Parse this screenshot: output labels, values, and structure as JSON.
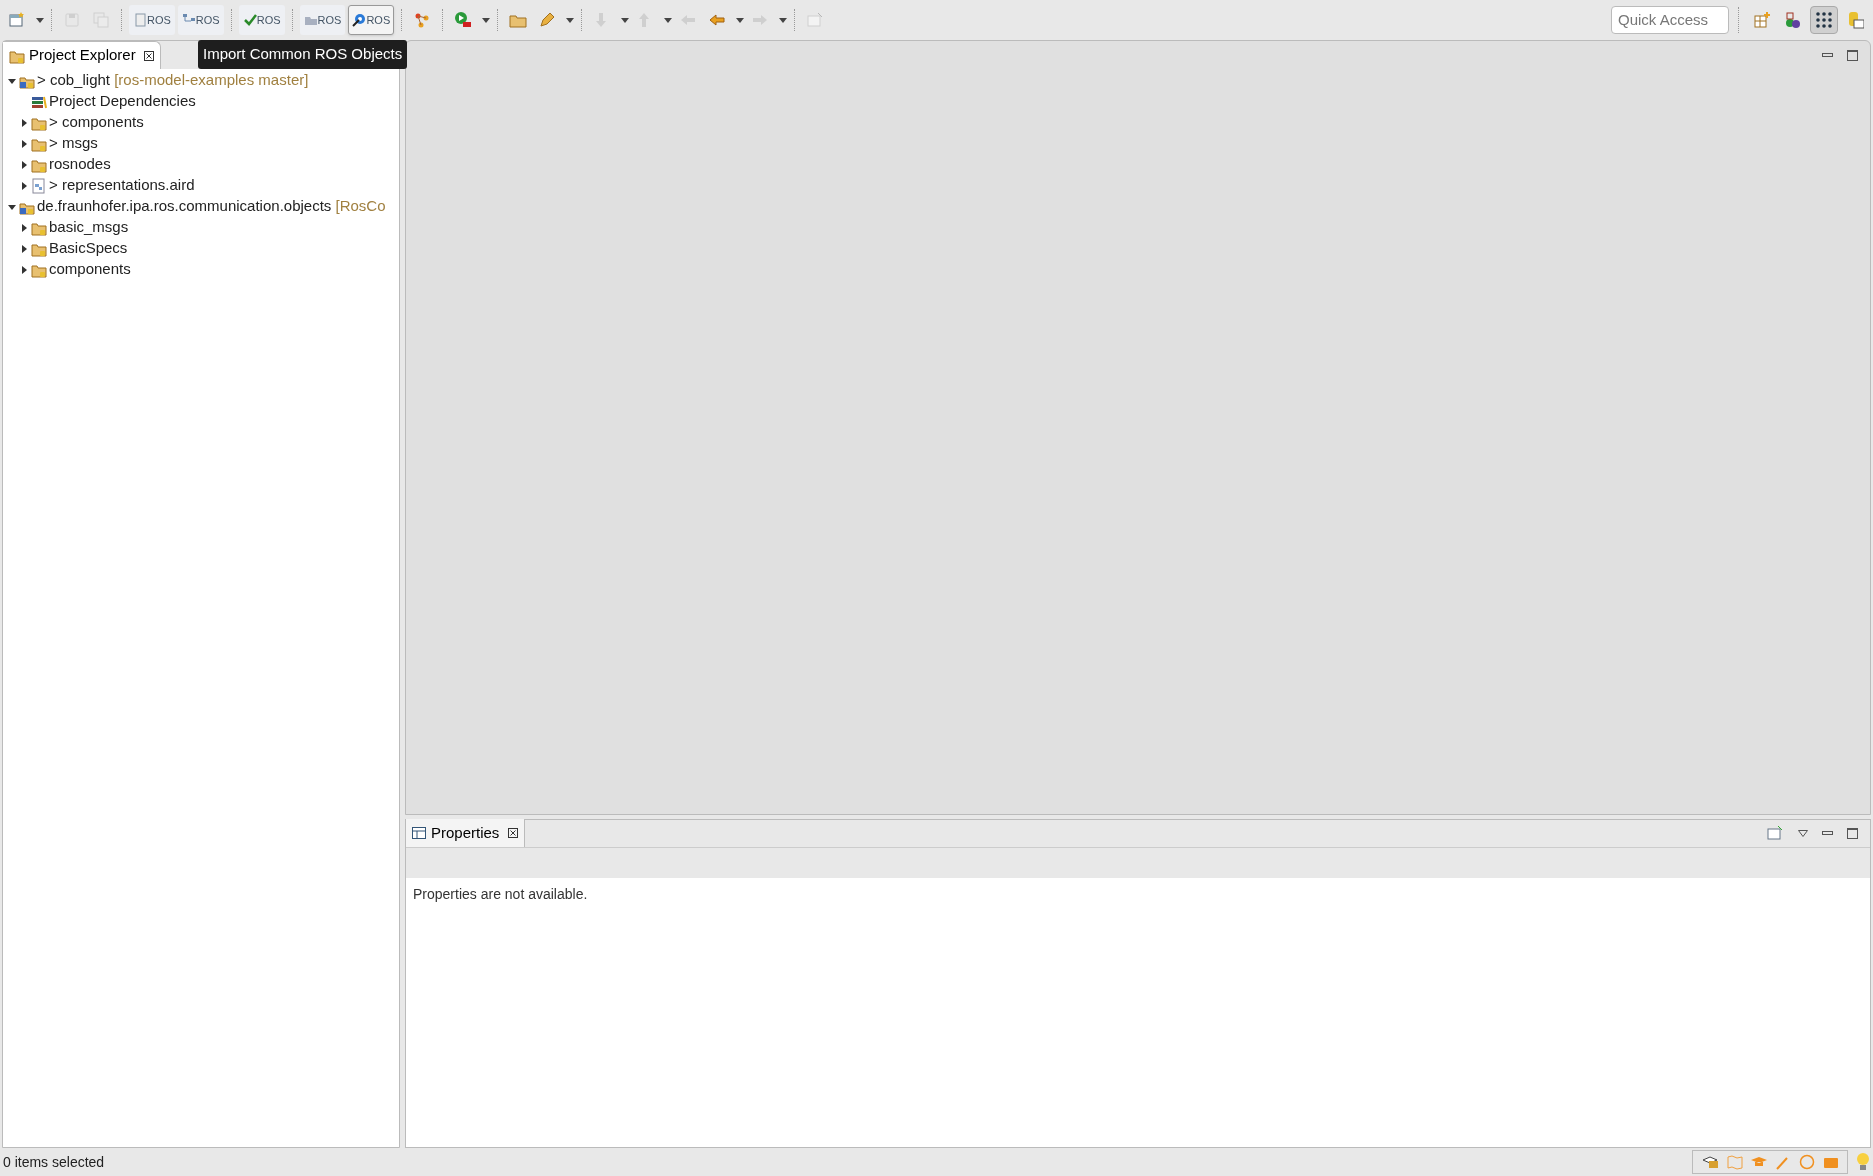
{
  "toolbar": [
    {
      "kind": "new-wizard",
      "dropdown": true,
      "disabled": false
    },
    {
      "kind": "separator"
    },
    {
      "kind": "save",
      "disabled": true
    },
    {
      "kind": "save-all",
      "disabled": true
    },
    {
      "kind": "separator"
    },
    {
      "kind": "ros-file",
      "label": "ROS",
      "selected": false
    },
    {
      "kind": "ros-graph",
      "label": "ROS",
      "selected": false
    },
    {
      "kind": "separator"
    },
    {
      "kind": "ros-check",
      "label": "ROS",
      "selected": false
    },
    {
      "kind": "separator"
    },
    {
      "kind": "ros-folder",
      "label": "ROS",
      "selected": false
    },
    {
      "kind": "ros-gear",
      "label": "ROS",
      "selected": true
    },
    {
      "kind": "separator"
    },
    {
      "kind": "nodes",
      "disabled": false
    },
    {
      "kind": "separator"
    },
    {
      "kind": "run",
      "dropdown": true,
      "disabled": false
    },
    {
      "kind": "separator"
    },
    {
      "kind": "open-folder",
      "disabled": false
    },
    {
      "kind": "pen",
      "dropdown": true,
      "disabled": false
    },
    {
      "kind": "separator"
    },
    {
      "kind": "down",
      "dropdown": true,
      "disabled": true
    },
    {
      "kind": "up",
      "dropdown": true,
      "disabled": true
    },
    {
      "kind": "back-edit",
      "disabled": true
    },
    {
      "kind": "back",
      "dropdown": true,
      "disabled": false
    },
    {
      "kind": "forward",
      "dropdown": true,
      "disabled": true
    },
    {
      "kind": "separator"
    },
    {
      "kind": "pin",
      "disabled": true
    }
  ],
  "tooltip": "Import Common ROS Objects",
  "quick_access": {
    "placeholder": "Quick Access"
  },
  "perspectives": [
    {
      "kind": "open-perspective",
      "selected": false
    },
    {
      "kind": "ros",
      "selected": false
    },
    {
      "kind": "grid",
      "selected": true
    },
    {
      "kind": "git",
      "selected": false
    }
  ],
  "project_explorer": {
    "title": "Project Explorer",
    "tree": [
      {
        "kind": "project",
        "prefix": ">",
        "name": "cob_light",
        "decoration": "[ros-model-examples master]",
        "expanded": true,
        "children": [
          {
            "kind": "dependencies",
            "name": "Project Dependencies"
          },
          {
            "kind": "folder",
            "prefix": ">",
            "name": "components",
            "expanded": false
          },
          {
            "kind": "folder",
            "prefix": ">",
            "name": "msgs",
            "expanded": false
          },
          {
            "kind": "folder",
            "name": "rosnodes",
            "expanded": false
          },
          {
            "kind": "file",
            "prefix": ">",
            "name": "representations.aird",
            "expanded": false
          }
        ]
      },
      {
        "kind": "project",
        "name": "de.fraunhofer.ipa.ros.communication.objects",
        "decoration": "[RosCo",
        "expanded": true,
        "children": [
          {
            "kind": "folder",
            "name": "basic_msgs",
            "expanded": false
          },
          {
            "kind": "folder",
            "name": "BasicSpecs",
            "expanded": false
          },
          {
            "kind": "folder",
            "name": "components",
            "expanded": false
          }
        ]
      }
    ]
  },
  "properties": {
    "title": "Properties",
    "message": "Properties are not available."
  },
  "status_bar": {
    "text": "0 items selected"
  }
}
